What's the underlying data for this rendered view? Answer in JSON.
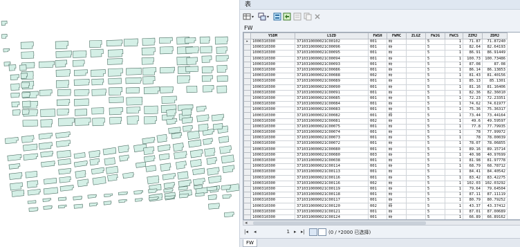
{
  "window": {
    "title": "表"
  },
  "toolbar": {
    "icons": [
      "table-options-icon",
      "related-tables-icon",
      "select-by-attributes-icon",
      "switch-selection-icon",
      "clear-selection-icon",
      "delete-selected-icon"
    ]
  },
  "layer": {
    "name": "FW"
  },
  "table": {
    "columns": [
      "YSDM",
      "LSZD",
      "FWSH",
      "FWMC",
      "ZLGZ",
      "FWJG",
      "FWCS",
      "ZZMJ",
      "ZDMJ"
    ],
    "rows": [
      [
        "1000310300",
        "3710310000021C00102",
        "001",
        "砖",
        "",
        "5",
        "1",
        "71.87",
        "71.87240"
      ],
      [
        "1000310300",
        "3710310000021C00096",
        "001",
        "砖",
        "",
        "5",
        "1",
        "82.64",
        "82.64193"
      ],
      [
        "1000310300",
        "3710310000021C00095",
        "001",
        "砖",
        "",
        "5",
        "1",
        "86.91",
        "86.91449"
      ],
      [
        "1000310300",
        "3710310000021C00094",
        "001",
        "砖",
        "",
        "5",
        "1",
        "100.73",
        "100.73486"
      ],
      [
        "1000310300",
        "3710310000021C00093",
        "001",
        "砖",
        "",
        "5",
        "1",
        "87.08",
        "87.08"
      ],
      [
        "1000310300",
        "3710310000021C00086",
        "001",
        "砖",
        "",
        "5",
        "1",
        "86.14",
        "86.13853"
      ],
      [
        "1000310300",
        "3710310000021C00088",
        "002",
        "砖",
        "",
        "5",
        "1",
        "81.43",
        "81.40156"
      ],
      [
        "1000310300",
        "3710310000021C00089",
        "001",
        "砖",
        "",
        "5",
        "1",
        "85.13",
        "85.1301"
      ],
      [
        "1000310300",
        "3710310000021C00090",
        "001",
        "砖",
        "",
        "5",
        "1",
        "81.16",
        "81.16406"
      ],
      [
        "1000310300",
        "3710310000021C00091",
        "001",
        "砖",
        "",
        "5",
        "1",
        "82.36",
        "82.36010"
      ],
      [
        "1000310300",
        "3710310000021C00085",
        "001",
        "砖",
        "",
        "5",
        "1",
        "72.23",
        "72.23351"
      ],
      [
        "1000310300",
        "3710310000021C00084",
        "001",
        "砖",
        "",
        "5",
        "1",
        "74.62",
        "74.61977"
      ],
      [
        "1000310300",
        "3710310000021C00083",
        "001",
        "砖",
        "",
        "5",
        "1",
        "75.36",
        "75.36317"
      ],
      [
        "1000310300",
        "3710310000021C00082",
        "001",
        "砖",
        "",
        "5",
        "1",
        "73.44",
        "73.44164"
      ],
      [
        "1000310300",
        "3710310000021C00081",
        "002",
        "砖",
        "",
        "5",
        "1",
        "49.6",
        "49.59597"
      ],
      [
        "1000310300",
        "3710310000021C00075",
        "001",
        "砖",
        "",
        "5",
        "1",
        "77.8",
        "77.79935"
      ],
      [
        "1000310300",
        "3710310000021C00074",
        "001",
        "砖",
        "",
        "5",
        "1",
        "78",
        "77.99972"
      ],
      [
        "1000310300",
        "3710310000021C00073",
        "001",
        "砖",
        "",
        "5",
        "1",
        "78",
        "78.00039"
      ],
      [
        "1000310300",
        "3710310000021C00072",
        "001",
        "砖",
        "",
        "5",
        "1",
        "78.07",
        "78.06855"
      ],
      [
        "1000310300",
        "3710310000021C00080",
        "001",
        "砖",
        "",
        "5",
        "1",
        "89.16",
        "89.15714"
      ],
      [
        "1000310300",
        "3710310000021C00080",
        "003",
        "砖",
        "",
        "5",
        "1",
        "40.98",
        "40.97699"
      ],
      [
        "1000310300",
        "3710310000021C00038",
        "001",
        "砖",
        "",
        "5",
        "1",
        "81.98",
        "81.97778"
      ],
      [
        "1000310300",
        "3710310000021C00114",
        "001",
        "砖",
        "",
        "5",
        "1",
        "68.79",
        "68.78712"
      ],
      [
        "1000310300",
        "3710310000021C00113",
        "001",
        "砖",
        "",
        "5",
        "1",
        "84.41",
        "84.40542"
      ],
      [
        "1000310300",
        "3710310000021C00116",
        "001",
        "砖",
        "",
        "5",
        "1",
        "83.42",
        "83.42275"
      ],
      [
        "1000310300",
        "3710310000021C00116",
        "002",
        "砖",
        "",
        "5",
        "1",
        "102.03",
        "102.03292"
      ],
      [
        "1000310300",
        "3710310000021C00119",
        "001",
        "砖",
        "",
        "5",
        "1",
        "79.64",
        "79.64504"
      ],
      [
        "1000310300",
        "3710310000021C00118",
        "001",
        "砖",
        "",
        "5",
        "1",
        "87.11",
        "87.11119"
      ],
      [
        "1000310300",
        "3710310000021C00117",
        "001",
        "砖",
        "",
        "5",
        "1",
        "80.79",
        "80.79252"
      ],
      [
        "1000310300",
        "3710310000021C00120",
        "002",
        "砖",
        "",
        "5",
        "1",
        "43.37",
        "43.37412"
      ],
      [
        "1000310300",
        "3710310000021C00121",
        "001",
        "砖",
        "",
        "5",
        "1",
        "87.01",
        "87.00689"
      ],
      [
        "1000310300",
        "3710310000021C00124",
        "001",
        "砖",
        "",
        "5",
        "1",
        "66.89",
        "66.89162"
      ]
    ],
    "selected_row": 0
  },
  "pager": {
    "current_record": "1",
    "status": "(0 / *2000 已选择)"
  },
  "tab": {
    "label": "FW"
  },
  "colors": {
    "building_fill": "#d4efe6",
    "building_stroke": "#4e6f64",
    "window_bg": "#eef2f7"
  }
}
